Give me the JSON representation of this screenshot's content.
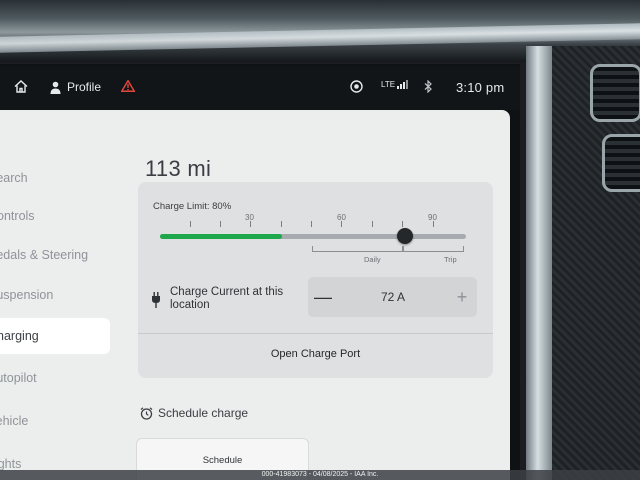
{
  "status_bar": {
    "profile_label": "Profile",
    "network_label": "LTE",
    "time": "3:10 pm",
    "icons": [
      "home-icon",
      "person-icon",
      "warning-icon",
      "security-camera-icon",
      "signal-icon",
      "bluetooth-icon"
    ],
    "warning_color": "#e0463b"
  },
  "sidebar": {
    "items": [
      {
        "label": "Search",
        "active": false
      },
      {
        "label": "Controls",
        "active": false
      },
      {
        "label": "Pedals & Steering",
        "active": false
      },
      {
        "label": "Suspension",
        "active": false
      },
      {
        "label": "Charging",
        "active": true
      },
      {
        "label": "Autopilot",
        "active": false
      },
      {
        "label": "Vehicle",
        "active": false
      },
      {
        "label": "Lights",
        "active": false
      }
    ]
  },
  "charging": {
    "range": "113 mi",
    "charge_limit_label": "Charge Limit: 80%",
    "charge_limit_value": 80,
    "current_charge_fraction": 0.4,
    "scale_labels": [
      "30",
      "60",
      "90"
    ],
    "zone_labels": [
      "Daily",
      "Trip"
    ],
    "accent_color": "#1fa74b",
    "charge_current_label": "Charge Current at this location",
    "charge_current_value": "72 A",
    "decrease_symbol": "—",
    "increase_symbol": "+",
    "open_port_label": "Open Charge Port",
    "schedule_title": "Schedule charge",
    "schedule_button_label": "Schedule"
  },
  "watermark": "000-41983073 - 04/08/2025 - IAA Inc."
}
